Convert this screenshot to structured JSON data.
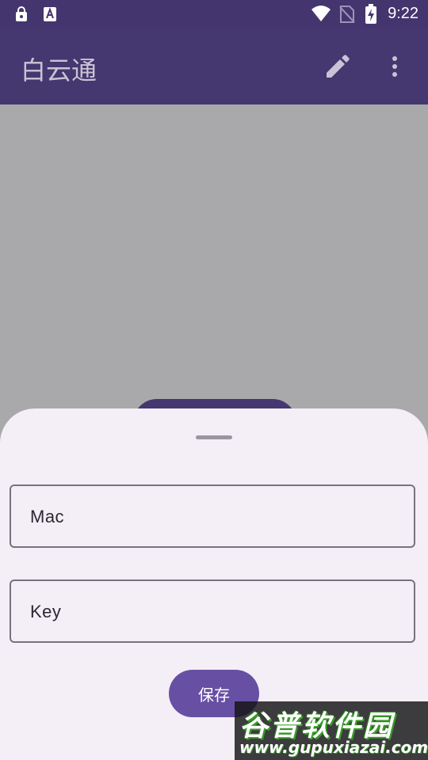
{
  "status_bar": {
    "time": "9:22",
    "icons": [
      "lock-notification-icon",
      "text-notification-icon",
      "wifi-icon",
      "no-sim-icon",
      "battery-charging-icon"
    ]
  },
  "app_bar": {
    "title": "白云通",
    "actions": [
      "edit-icon",
      "more-vert-icon"
    ],
    "color": "#45376f"
  },
  "bottom_sheet": {
    "mac_field": {
      "placeholder": "Mac",
      "value": ""
    },
    "key_field": {
      "placeholder": "Key",
      "value": ""
    },
    "save_label": "保存"
  },
  "watermark": {
    "title": "谷普软件园",
    "url": "www.gupuxiazai.com"
  },
  "colors": {
    "primary": "#6750a4",
    "sheet_bg": "#f4eff7",
    "scrim": "#a9a8ab"
  }
}
